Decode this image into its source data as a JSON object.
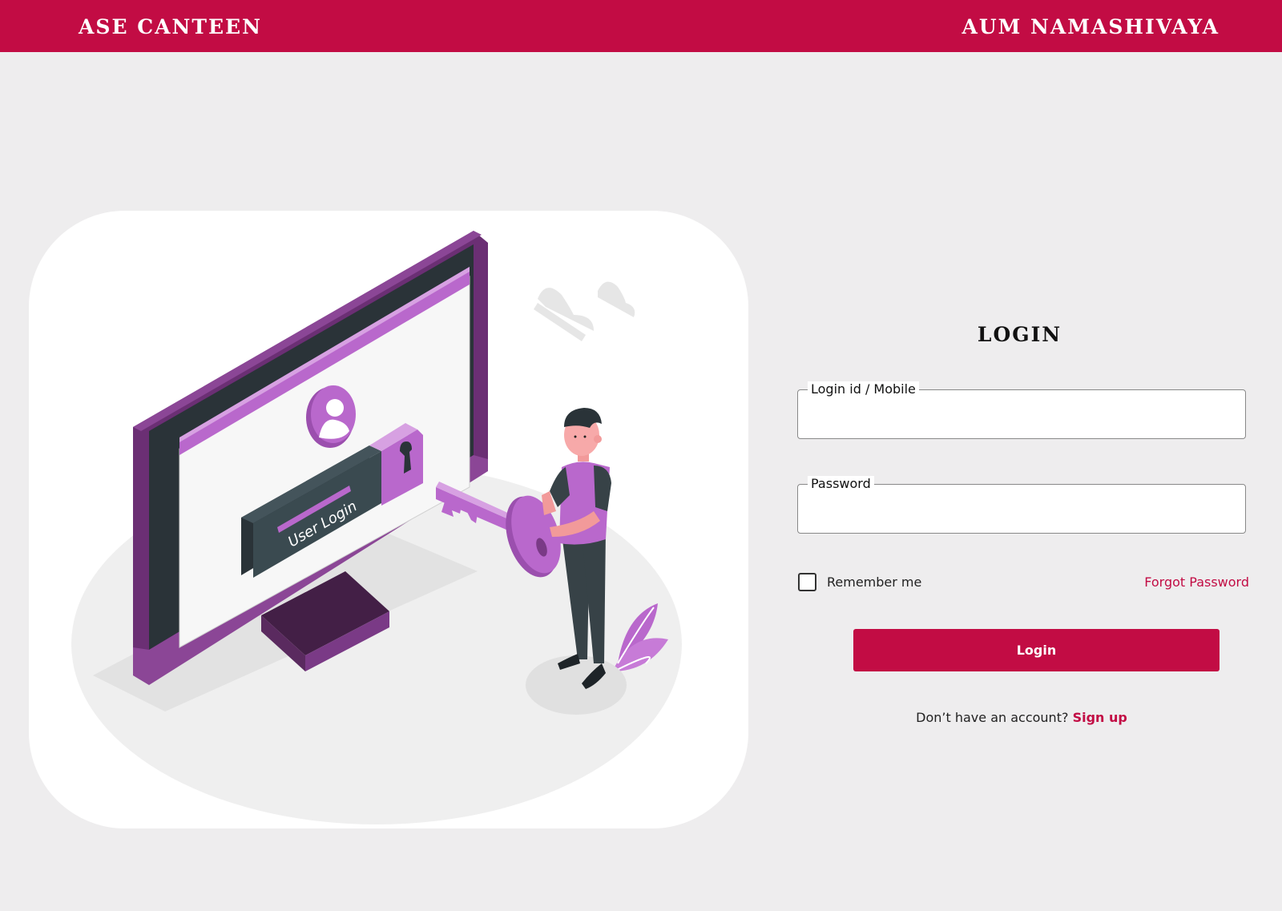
{
  "header": {
    "brand": "ASE CANTEEN",
    "greeting": "AUM NAMASHIVAYA"
  },
  "illustration": {
    "screen_text": "User Login"
  },
  "form": {
    "title": "LOGIN",
    "login_label": "Login id / Mobile",
    "login_value": "",
    "password_label": "Password",
    "password_value": "",
    "remember_label": "Remember me",
    "remember_checked": false,
    "forgot_label": "Forgot Password",
    "submit_label": "Login",
    "signup_prompt": "Don’t have an account?",
    "signup_link": "Sign up"
  },
  "colors": {
    "brand": "#c20c44",
    "accent_purple": "#b968cc",
    "dark_purple": "#7a3a86",
    "background": "#eeedee"
  }
}
